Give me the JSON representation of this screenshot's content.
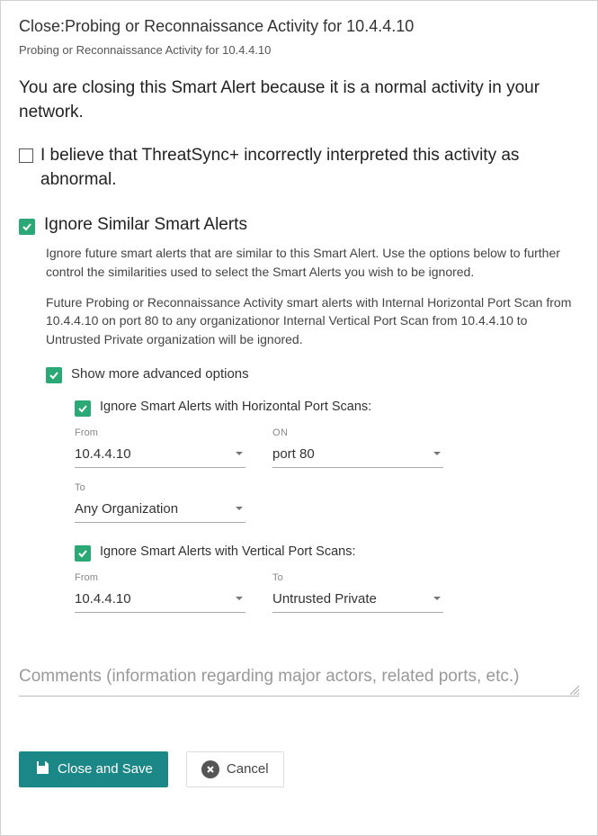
{
  "dialog": {
    "title": "Close:Probing or Reconnaissance Activity for 10.4.4.10",
    "subtitle": "Probing or Reconnaissance Activity for 10.4.4.10",
    "reason": "You are closing this Smart Alert because it is a normal activity in your network.",
    "incorrectInterpretation": {
      "checked": false,
      "label": "I believe that ThreatSync+ incorrectly interpreted this activity as abnormal."
    },
    "ignoreSection": {
      "checked": true,
      "heading": "Ignore Similar Smart Alerts",
      "description": "Ignore future smart alerts that are similar to this Smart Alert. Use the options below to further control the similarities used to select the Smart Alerts you wish to be ignored.",
      "futureNote": "Future Probing or Reconnaissance Activity smart alerts with Internal Horizontal Port Scan from 10.4.4.10 on port 80 to any organizationor Internal Vertical Port Scan from 10.4.4.10 to Untrusted Private organization will be ignored.",
      "advanced": {
        "checked": true,
        "label": "Show more advanced options",
        "horizontal": {
          "checked": true,
          "label": "Ignore Smart Alerts with Horizontal Port Scans:",
          "fromCaption": "From",
          "fromValue": "10.4.4.10",
          "onCaption": "ON",
          "onValue": "port 80",
          "toCaption": "To",
          "toValue": "Any Organization"
        },
        "vertical": {
          "checked": true,
          "label": "Ignore Smart Alerts with Vertical Port Scans:",
          "fromCaption": "From",
          "fromValue": "10.4.4.10",
          "toCaption": "To",
          "toValue": "Untrusted Private"
        }
      }
    },
    "commentsPlaceholder": "Comments (information regarding major actors, related ports, etc.)",
    "buttons": {
      "save": "Close and Save",
      "cancel": "Cancel"
    }
  }
}
